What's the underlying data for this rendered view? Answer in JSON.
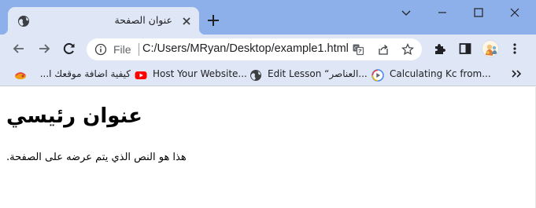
{
  "tab": {
    "title": "عنوان الصفحة",
    "icon": "globe-icon"
  },
  "window_controls": [
    "chevron-down-icon",
    "minimize-icon",
    "maximize-icon",
    "close-icon"
  ],
  "omnibox": {
    "scheme_label": "File",
    "url": "C:/Users/MRyan/Desktop/example1.html"
  },
  "bookmarks": [
    {
      "label": "كيفية اضافة موقعك ا...",
      "icon": "bookmark-favicon-icon"
    },
    {
      "label": "Host Your Website...",
      "icon": "youtube-icon"
    },
    {
      "label": "Edit Lesson “العناصر...",
      "icon": "globe-icon"
    },
    {
      "label": "Calculating Kc from...",
      "icon": "play-circle-icon"
    }
  ],
  "page": {
    "heading": "عنوان رئيسي",
    "paragraph": "هذا هو النص الذي يتم عرضه على الصفحة."
  },
  "colors": {
    "titlebar": "#8eb0ea",
    "toolbar": "#dfe7f6",
    "omnibox": "#ffffff"
  }
}
